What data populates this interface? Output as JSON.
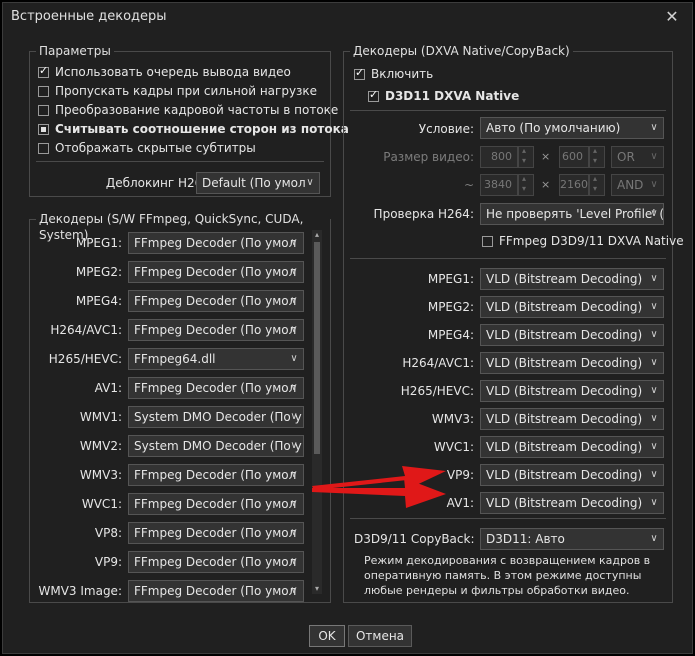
{
  "window": {
    "title": "Встроенные декодеры",
    "close_glyph": "✕"
  },
  "params": {
    "legend": "Параметры",
    "checkboxes": [
      {
        "label": "Использовать очередь вывода видео",
        "state": "checked"
      },
      {
        "label": "Пропускать кадры при сильной нагрузке",
        "state": "unchecked"
      },
      {
        "label": "Преобразование кадровой частоты в потоке",
        "state": "unchecked"
      },
      {
        "label": "Считывать соотношение сторон из потока",
        "state": "indeterminate"
      },
      {
        "label": "Отображать скрытые субтитры",
        "state": "unchecked"
      }
    ],
    "deblock_label": "Деблокинг H264:",
    "deblock_value": "Default (По умол"
  },
  "sw_decoders": {
    "legend": "Декодеры (S/W FFmpeg, QuickSync, CUDA, System)",
    "rows": [
      {
        "label": "MPEG1:",
        "value": "FFmpeg Decoder (По умол"
      },
      {
        "label": "MPEG2:",
        "value": "FFmpeg Decoder (По умол"
      },
      {
        "label": "MPEG4:",
        "value": "FFmpeg Decoder (По умол"
      },
      {
        "label": "H264/AVC1:",
        "value": "FFmpeg Decoder (По умол"
      },
      {
        "label": "H265/HEVC:",
        "value": "FFmpeg64.dll"
      },
      {
        "label": "AV1:",
        "value": "FFmpeg Decoder (По умол"
      },
      {
        "label": "WMV1:",
        "value": "System DMO Decoder (По у"
      },
      {
        "label": "WMV2:",
        "value": "System DMO Decoder (По у"
      },
      {
        "label": "WMV3:",
        "value": "FFmpeg Decoder (По умол"
      },
      {
        "label": "WVC1:",
        "value": "FFmpeg Decoder (По умол"
      },
      {
        "label": "VP8:",
        "value": "FFmpeg Decoder (По умол"
      },
      {
        "label": "VP9:",
        "value": "FFmpeg Decoder (По умол"
      },
      {
        "label": "WMV3 Image:",
        "value": "FFmpeg Decoder (По умол"
      }
    ]
  },
  "dxva": {
    "legend": "Декодеры (DXVA Native/CopyBack)",
    "enable_label": "Включить",
    "d3d11_label": "D3D11 DXVA Native",
    "condition_label": "Условие:",
    "condition_value": "Авто (По умолчанию)",
    "size_label": "Размер видео:",
    "size_w": "800",
    "size_h": "600",
    "size_op": "OR",
    "range_label": "~",
    "max_w": "3840",
    "max_h": "2160",
    "max_op": "AND",
    "times": "×",
    "h264_check_label": "Проверка H264:",
    "h264_check_value": "Не проверять 'Level Profile' (",
    "ffmpeg_d3d_label": "FFmpeg D3D9/11 DXVA Native",
    "rows": [
      {
        "label": "MPEG1:",
        "value": "VLD (Bitstream Decoding)"
      },
      {
        "label": "MPEG2:",
        "value": "VLD (Bitstream Decoding)"
      },
      {
        "label": "MPEG4:",
        "value": "VLD (Bitstream Decoding)"
      },
      {
        "label": "H264/AVC1:",
        "value": "VLD (Bitstream Decoding)"
      },
      {
        "label": "H265/HEVC:",
        "value": "VLD (Bitstream Decoding)"
      },
      {
        "label": "WMV3:",
        "value": "VLD (Bitstream Decoding)"
      },
      {
        "label": "WVC1:",
        "value": "VLD (Bitstream Decoding)"
      },
      {
        "label": "VP9:",
        "value": "VLD (Bitstream Decoding)"
      },
      {
        "label": "AV1:",
        "value": "VLD (Bitstream Decoding)"
      }
    ],
    "copyback_label": "D3D9/11 CopyBack:",
    "copyback_value": "D3D11: Авто",
    "desc_lines": [
      "Режим декодирования с возвращением кадров в",
      "оперативную память. В этом режиме доступны",
      "любые рендеры и фильтры обработки видео."
    ]
  },
  "buttons": {
    "ok": "OK",
    "cancel": "Отмена"
  },
  "colors": {
    "annotation_arrow": "#e01818",
    "window_bg": "#202020"
  }
}
